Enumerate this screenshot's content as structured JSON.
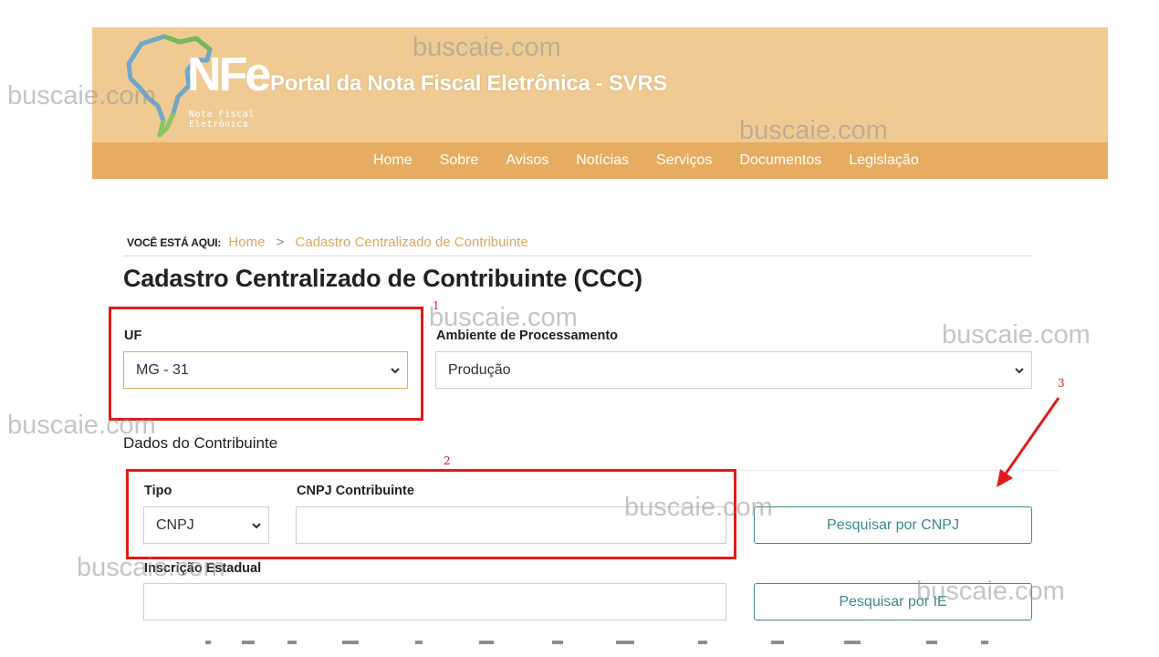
{
  "header": {
    "logo_text": "NFe",
    "logo_subtext": "Nota Fiscal Eletrônica",
    "title": "Portal da Nota Fiscal Eletrônica - SVRS",
    "nav": [
      {
        "label": "Home"
      },
      {
        "label": "Sobre"
      },
      {
        "label": "Avisos"
      },
      {
        "label": "Notícias"
      },
      {
        "label": "Serviços"
      },
      {
        "label": "Documentos"
      },
      {
        "label": "Legislação"
      }
    ]
  },
  "breadcrumb": {
    "prefix": "VOCÊ ESTÁ AQUI:",
    "home": "Home",
    "separator": ">",
    "current": "Cadastro Centralizado de Contribuinte"
  },
  "page_title": "Cadastro Centralizado de Contribuinte (CCC)",
  "form": {
    "uf_label": "UF",
    "uf_value": "MG - 31",
    "ambiente_label": "Ambiente de Processamento",
    "ambiente_value": "Produção",
    "section_title": "Dados do Contribuinte",
    "tipo_label": "Tipo",
    "tipo_value": "CNPJ",
    "cnpj_label": "CNPJ Contribuinte",
    "cnpj_value": "",
    "search_cnpj_button": "Pesquisar por CNPJ",
    "ie_label": "Inscrição Estadual",
    "ie_value": "",
    "search_ie_button": "Pesquisar por IE"
  },
  "annotations": [
    "1",
    "2",
    "3"
  ],
  "watermark": "buscaie.com",
  "colors": {
    "header_bg": "#efcb93",
    "nav_bg": "#e6ac62",
    "accent_link": "#d8a868",
    "button_border": "#3f8a8a",
    "annotation_red": "#e21b1b"
  }
}
